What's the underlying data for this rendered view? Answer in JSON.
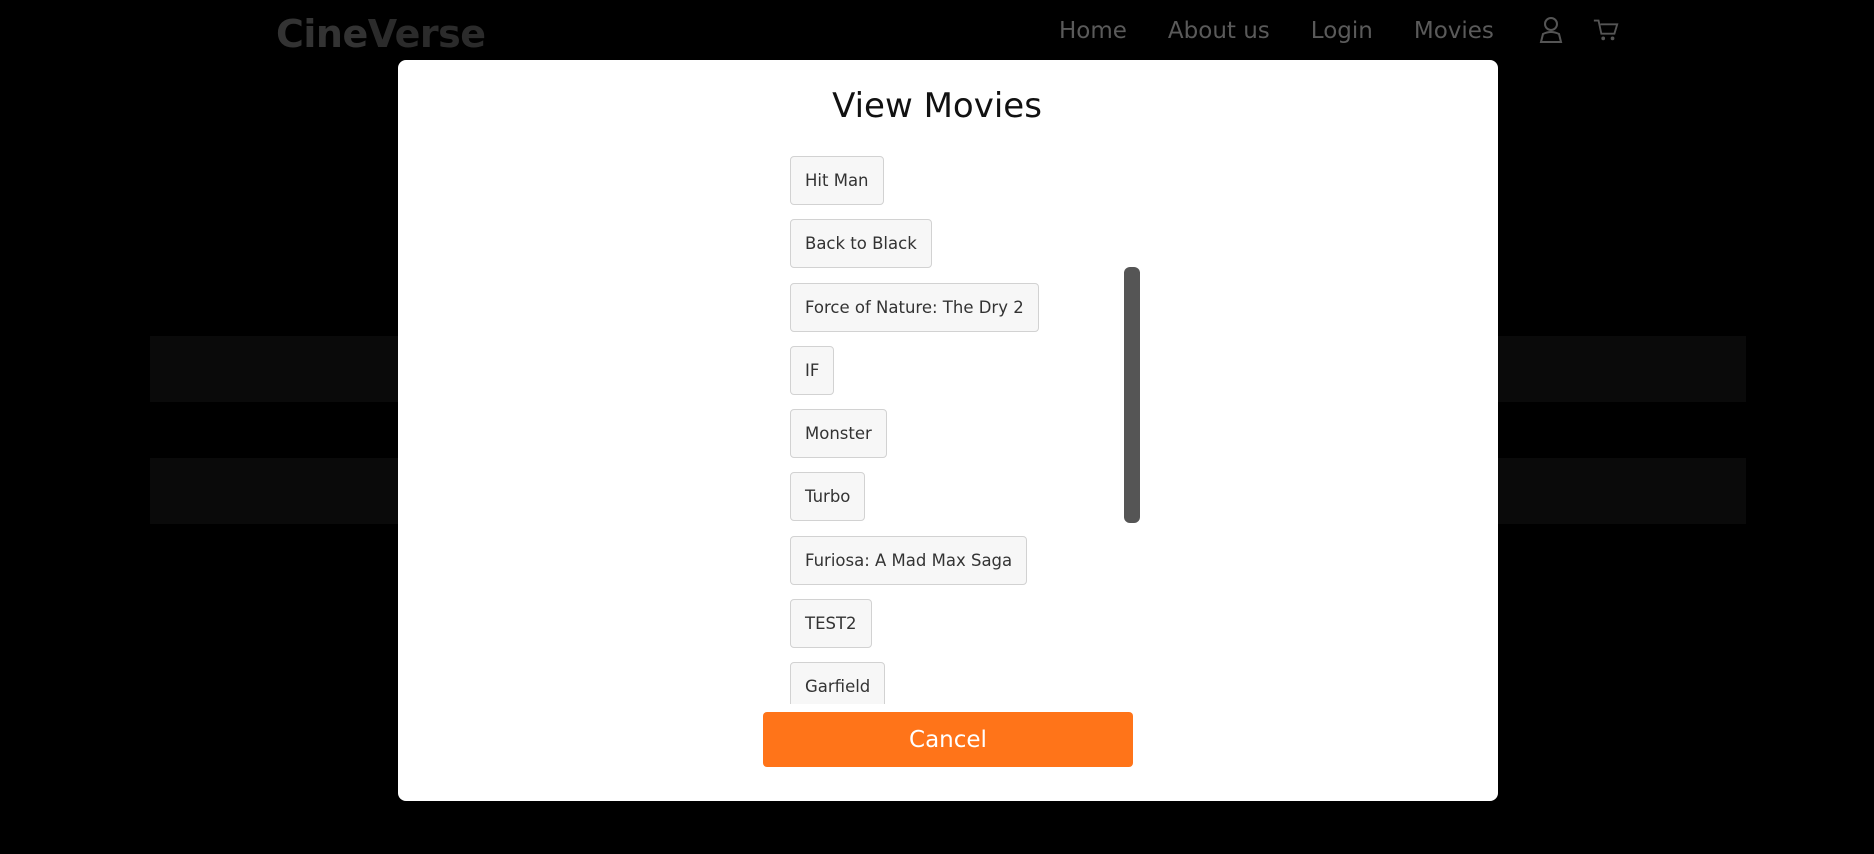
{
  "header": {
    "logo_part1": "Cine",
    "logo_part2": "Verse",
    "nav": [
      "Home",
      "About us",
      "Login",
      "Movies"
    ],
    "icons": [
      "user-icon",
      "cart-icon"
    ]
  },
  "modal": {
    "title": "View Movies",
    "movies": [
      "Hit Man",
      "Back to Black",
      "Force of Nature: The Dry 2",
      "IF",
      "Monster",
      "Turbo",
      "Furiosa: A Mad Max Saga",
      "TEST2",
      "Garfield"
    ],
    "cancel_label": "Cancel"
  },
  "colors": {
    "accent": "#ff7419",
    "overlay": "#000000",
    "modal_bg": "#ffffff"
  }
}
